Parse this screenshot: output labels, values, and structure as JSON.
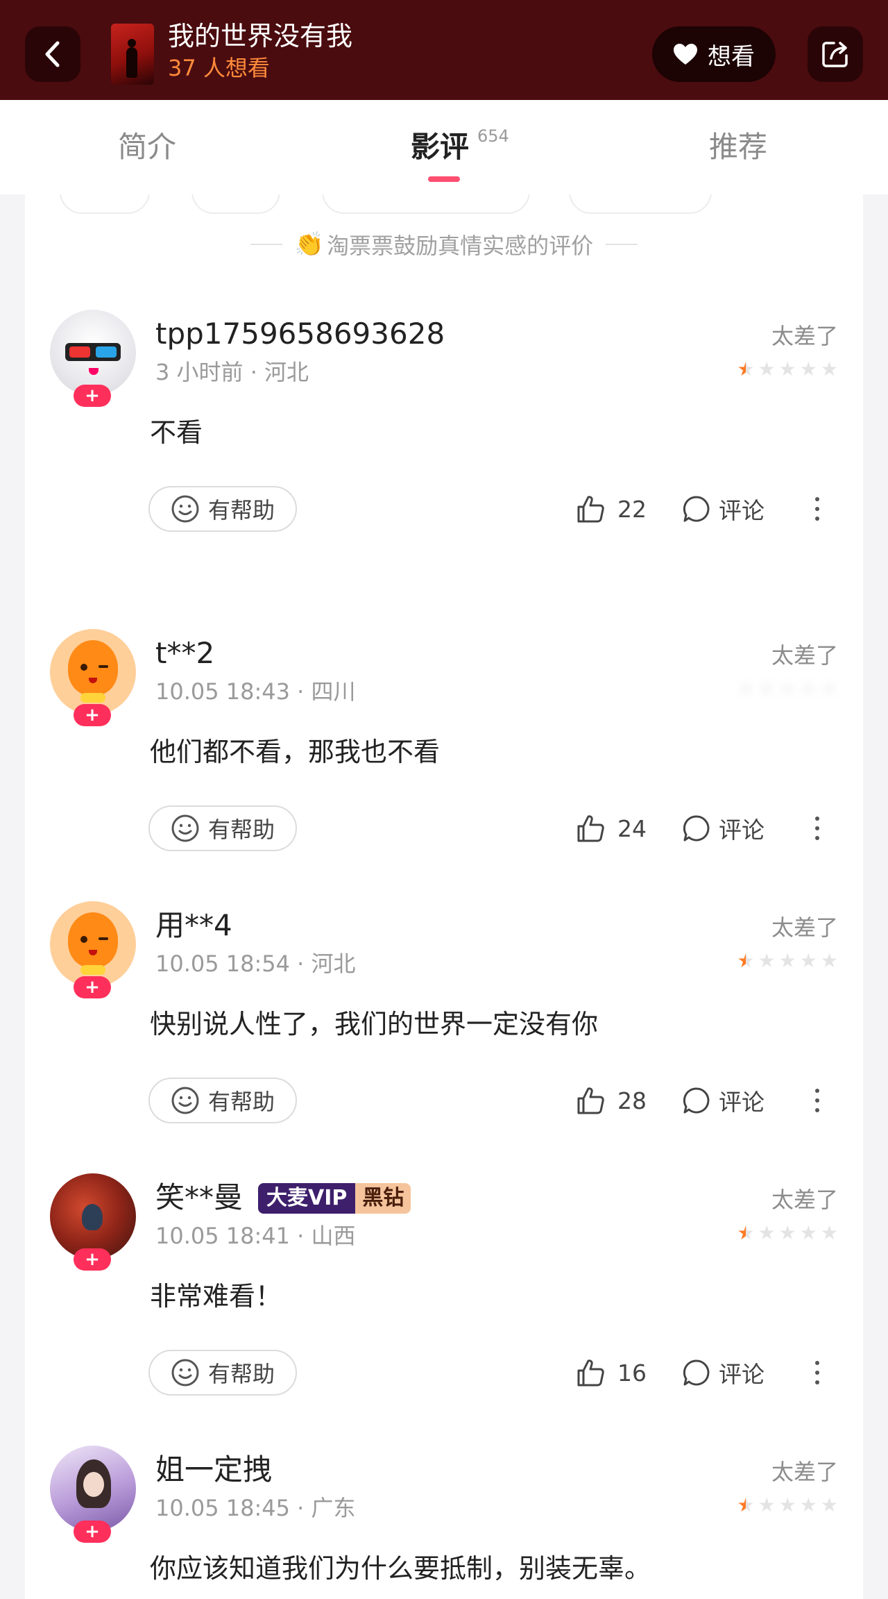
{
  "header": {
    "movie_title": "我的世界没有我",
    "want_count": "37 人想看",
    "want_button": "想看",
    "colors": {
      "background": "#4a0c0f",
      "accent": "#ff8a3b"
    }
  },
  "tabs": [
    {
      "label": "简介"
    },
    {
      "label": "影评",
      "count": "654",
      "active": true
    },
    {
      "label": "推荐"
    }
  ],
  "notice": {
    "emoji": "👏",
    "text": "淘票票鼓励真情实感的评价"
  },
  "reviews": [
    {
      "username": "tpp1759658693628",
      "meta": "3 小时前 · 河北",
      "rating_label": "太差了",
      "stars": 0.5,
      "content": "不看",
      "helpful_label": "有帮助",
      "likes": "22",
      "comment_label": "评论"
    },
    {
      "username": "t**2",
      "meta": "10.05 18:43 · 四川",
      "rating_label": "太差了",
      "content": "他们都不看，那我也不看",
      "helpful_label": "有帮助",
      "likes": "24",
      "comment_label": "评论"
    },
    {
      "username": "用**4",
      "meta": "10.05 18:54 · 河北",
      "rating_label": "太差了",
      "stars": 0.5,
      "content": "快别说人性了，我们的世界一定没有你",
      "helpful_label": "有帮助",
      "likes": "28",
      "comment_label": "评论"
    },
    {
      "username": "笑**曼",
      "badge_vip": "大麦VIP",
      "badge_tier": "黑钻",
      "meta": "10.05 18:41 · 山西",
      "rating_label": "太差了",
      "stars": 0.5,
      "content": "非常难看！",
      "helpful_label": "有帮助",
      "likes": "16",
      "comment_label": "评论"
    },
    {
      "username": "姐一定拽",
      "meta": "10.05 18:45 · 广东",
      "rating_label": "太差了",
      "stars": 0.5,
      "content": "你应该知道我们为什么要抵制，别装无辜。"
    }
  ],
  "follow_label": "+",
  "star_color": "#ff7a22"
}
